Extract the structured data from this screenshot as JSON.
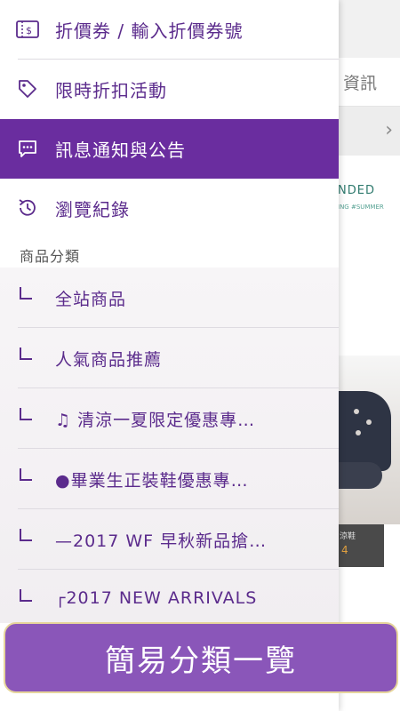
{
  "background": {
    "tab_label": "資訊",
    "banner_line1": "NDED",
    "banner_line2": "ING #SUMMER",
    "price_line1": "涼鞋",
    "price_line2": "4"
  },
  "drawer": {
    "items": [
      {
        "label": "折價券 / 輸入折價券號",
        "icon": "coupon-icon"
      },
      {
        "label": "限時折扣活動",
        "icon": "tag-icon"
      },
      {
        "label": "訊息通知與公告",
        "icon": "chat-icon"
      },
      {
        "label": "瀏覽紀錄",
        "icon": "history-icon"
      }
    ],
    "section_header": "商品分類",
    "categories": [
      {
        "label": "全站商品"
      },
      {
        "label": "人氣商品推薦"
      },
      {
        "label": "♫ 清涼一夏限定優惠專…"
      },
      {
        "label": "●畢業生正裝鞋優惠專…"
      },
      {
        "label": "—2017 WF 早秋新品搶…"
      },
      {
        "label": "┌2017 NEW ARRIVALS"
      }
    ]
  },
  "overlay_button": {
    "label": "簡易分類一覽"
  },
  "colors": {
    "accent": "#6a2d9f",
    "text_purple": "#5b2b8c",
    "overlay": "#8a56b9",
    "overlay_border": "#e6d59c"
  }
}
